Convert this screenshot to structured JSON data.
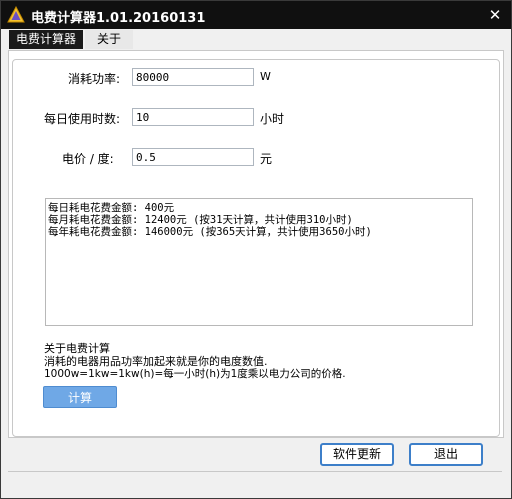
{
  "window": {
    "title": "电费计算器1.01.20160131",
    "close_glyph": "✕"
  },
  "tabs": [
    {
      "label": "电费计算器"
    },
    {
      "label": "关于"
    }
  ],
  "form": {
    "power": {
      "label": "消耗功率:",
      "value": "80000",
      "unit": "W"
    },
    "hours": {
      "label": "每日使用时数:",
      "value": "10",
      "unit": "小时"
    },
    "price": {
      "label": "电价 / 度:",
      "value": "0.5",
      "unit": "元"
    }
  },
  "result": {
    "text": "每日耗电花费金额: 400元\n每月耗电花费金额: 12400元 (按31天计算，共计使用310小时)\n每年耗电花费金额: 146000元 (按365天计算，共计使用3650小时)"
  },
  "about": {
    "title": "关于电费计算",
    "line1": "消耗的电器用品功率加起来就是你的电度数值.",
    "line2": "1000w=1kw=1kw(h)=每一小时(h)为1度乘以电力公司的价格."
  },
  "buttons": {
    "calculate": "计算",
    "update": "软件更新",
    "exit": "退出"
  },
  "icons": {
    "app_icon": "warning-triangle-icon"
  }
}
